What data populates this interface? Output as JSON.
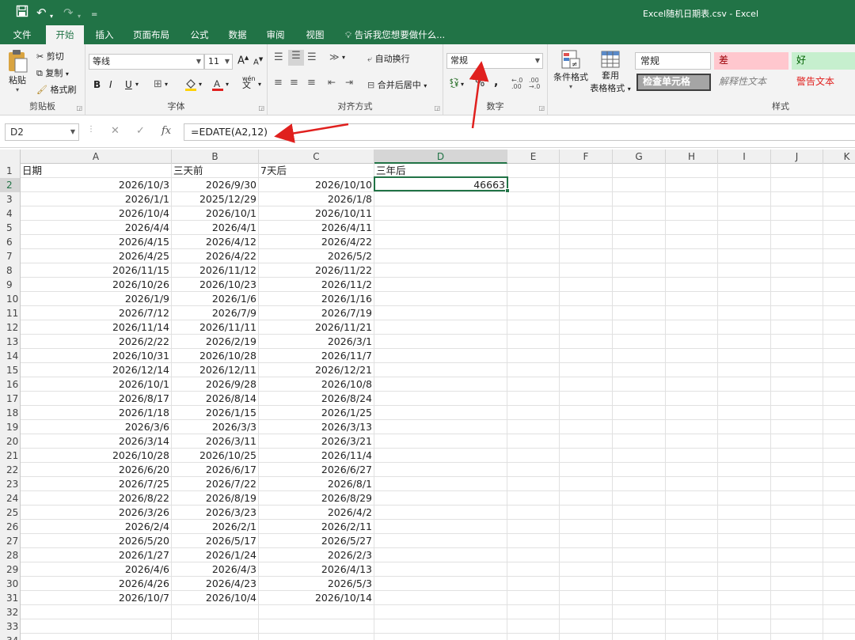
{
  "window": {
    "title": "Excel随机日期表.csv - Excel"
  },
  "quick_access": {
    "customize": "="
  },
  "tabs": [
    {
      "label": "文件"
    },
    {
      "label": "开始"
    },
    {
      "label": "插入"
    },
    {
      "label": "页面布局"
    },
    {
      "label": "公式"
    },
    {
      "label": "数据"
    },
    {
      "label": "审阅"
    },
    {
      "label": "视图"
    }
  ],
  "tell_me": "告诉我您想要做什么...",
  "clipboard": {
    "paste": "粘贴",
    "cut": "剪切",
    "copy": "复制",
    "format_painter": "格式刷",
    "group": "剪贴板"
  },
  "font": {
    "name": "等线",
    "size": "11",
    "bold": "B",
    "italic": "I",
    "underline": "U",
    "group": "字体",
    "grow": "A",
    "shrink": "A",
    "wen": "wén"
  },
  "alignment": {
    "wrap": "自动换行",
    "merge": "合并后居中",
    "group": "对齐方式"
  },
  "number": {
    "format": "常规",
    "percent": "%",
    "comma": ",",
    "group": "数字"
  },
  "styles": {
    "conditional": "条件格式",
    "table_line1": "套用",
    "table_line2": "表格格式",
    "normal": "常规",
    "bad": "差",
    "good": "好",
    "check_cell": "检查单元格",
    "explanatory": "解释性文本",
    "warning": "警告文本",
    "group": "样式"
  },
  "formula_bar": {
    "name_box": "D2",
    "formula": "=EDATE(A2,12)",
    "fx": "fx"
  },
  "columns": [
    "A",
    "B",
    "C",
    "D",
    "E",
    "F",
    "G",
    "H",
    "I",
    "J",
    "K"
  ],
  "headers": [
    "日期",
    "三天前",
    "7天后",
    "三年后"
  ],
  "rows": [
    [
      "2026/10/3",
      "2026/9/30",
      "2026/10/10",
      "46663"
    ],
    [
      "2026/1/1",
      "2025/12/29",
      "2026/1/8",
      ""
    ],
    [
      "2026/10/4",
      "2026/10/1",
      "2026/10/11",
      ""
    ],
    [
      "2026/4/4",
      "2026/4/1",
      "2026/4/11",
      ""
    ],
    [
      "2026/4/15",
      "2026/4/12",
      "2026/4/22",
      ""
    ],
    [
      "2026/4/25",
      "2026/4/22",
      "2026/5/2",
      ""
    ],
    [
      "2026/11/15",
      "2026/11/12",
      "2026/11/22",
      ""
    ],
    [
      "2026/10/26",
      "2026/10/23",
      "2026/11/2",
      ""
    ],
    [
      "2026/1/9",
      "2026/1/6",
      "2026/1/16",
      ""
    ],
    [
      "2026/7/12",
      "2026/7/9",
      "2026/7/19",
      ""
    ],
    [
      "2026/11/14",
      "2026/11/11",
      "2026/11/21",
      ""
    ],
    [
      "2026/2/22",
      "2026/2/19",
      "2026/3/1",
      ""
    ],
    [
      "2026/10/31",
      "2026/10/28",
      "2026/11/7",
      ""
    ],
    [
      "2026/12/14",
      "2026/12/11",
      "2026/12/21",
      ""
    ],
    [
      "2026/10/1",
      "2026/9/28",
      "2026/10/8",
      ""
    ],
    [
      "2026/8/17",
      "2026/8/14",
      "2026/8/24",
      ""
    ],
    [
      "2026/1/18",
      "2026/1/15",
      "2026/1/25",
      ""
    ],
    [
      "2026/3/6",
      "2026/3/3",
      "2026/3/13",
      ""
    ],
    [
      "2026/3/14",
      "2026/3/11",
      "2026/3/21",
      ""
    ],
    [
      "2026/10/28",
      "2026/10/25",
      "2026/11/4",
      ""
    ],
    [
      "2026/6/20",
      "2026/6/17",
      "2026/6/27",
      ""
    ],
    [
      "2026/7/25",
      "2026/7/22",
      "2026/8/1",
      ""
    ],
    [
      "2026/8/22",
      "2026/8/19",
      "2026/8/29",
      ""
    ],
    [
      "2026/3/26",
      "2026/3/23",
      "2026/4/2",
      ""
    ],
    [
      "2026/2/4",
      "2026/2/1",
      "2026/2/11",
      ""
    ],
    [
      "2026/5/20",
      "2026/5/17",
      "2026/5/27",
      ""
    ],
    [
      "2026/1/27",
      "2026/1/24",
      "2026/2/3",
      ""
    ],
    [
      "2026/4/6",
      "2026/4/3",
      "2026/4/13",
      ""
    ],
    [
      "2026/4/26",
      "2026/4/23",
      "2026/5/3",
      ""
    ],
    [
      "2026/10/7",
      "2026/10/4",
      "2026/10/14",
      ""
    ]
  ],
  "empty_rows": [
    "32",
    "33",
    "34"
  ],
  "colors": {
    "excel_green": "#217346",
    "arrow": "#e0201e",
    "bad_bg": "#ffc7ce",
    "good_bg": "#c6efce"
  }
}
